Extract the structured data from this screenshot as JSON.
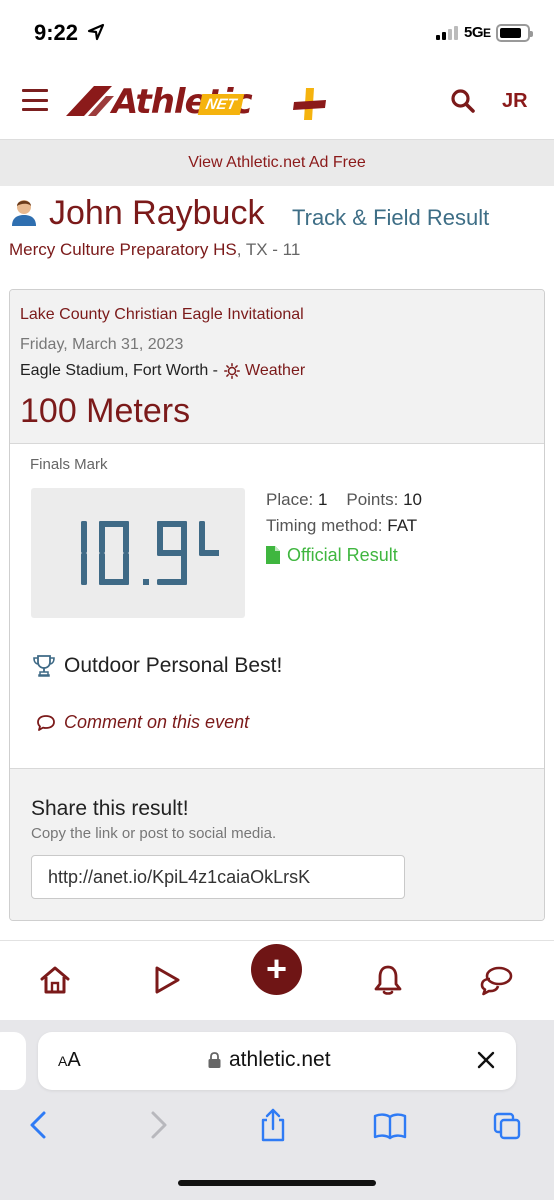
{
  "status": {
    "time": "9:22",
    "network": "5G",
    "network_suffix": "E"
  },
  "header": {
    "logo_word": "Athletic",
    "logo_badge": "NET",
    "avatar_initials": "JR",
    "icons": [
      "menu-icon",
      "search-icon"
    ]
  },
  "ad_bar": {
    "label": "View Athletic.net Ad Free"
  },
  "athlete": {
    "name": "John Raybuck",
    "page_subtitle": "Track & Field Result",
    "school": "Mercy Culture Preparatory HS",
    "school_extra": ", TX - 11"
  },
  "result": {
    "meet_name": "Lake County Christian Eagle Invitational",
    "meet_date": "Friday, March 31, 2023",
    "venue": "Eagle Stadium, Fort Worth -",
    "weather_label": "Weather",
    "event": "100 Meters",
    "finals_label": "Finals Mark",
    "mark": "10.94",
    "place_label": "Place:",
    "place_value": "1",
    "points_label": "Points:",
    "points_value": "10",
    "timing_label": "Timing method:",
    "timing_value": "FAT",
    "official_label": "Official Result",
    "pb_label": "Outdoor Personal Best!",
    "comment_label": "Comment on this event",
    "accent_color": "#7b1a1a",
    "mark_color": "#3f6a86",
    "official_color": "#3fb63f"
  },
  "share": {
    "title": "Share this result!",
    "subtitle": "Copy the link or post to social media.",
    "link": "http://anet.io/KpiL4z1caiaOkLrsK"
  },
  "bottom_nav": {
    "items": [
      "home-icon",
      "play-icon",
      "add-icon",
      "bell-icon",
      "chat-icon"
    ],
    "add_symbol": "+"
  },
  "browser": {
    "aa_small": "A",
    "aa_large": "A",
    "url": "athletic.net",
    "toolbar": [
      "back-icon",
      "forward-icon",
      "share-icon",
      "bookmarks-icon",
      "tabs-icon"
    ]
  }
}
